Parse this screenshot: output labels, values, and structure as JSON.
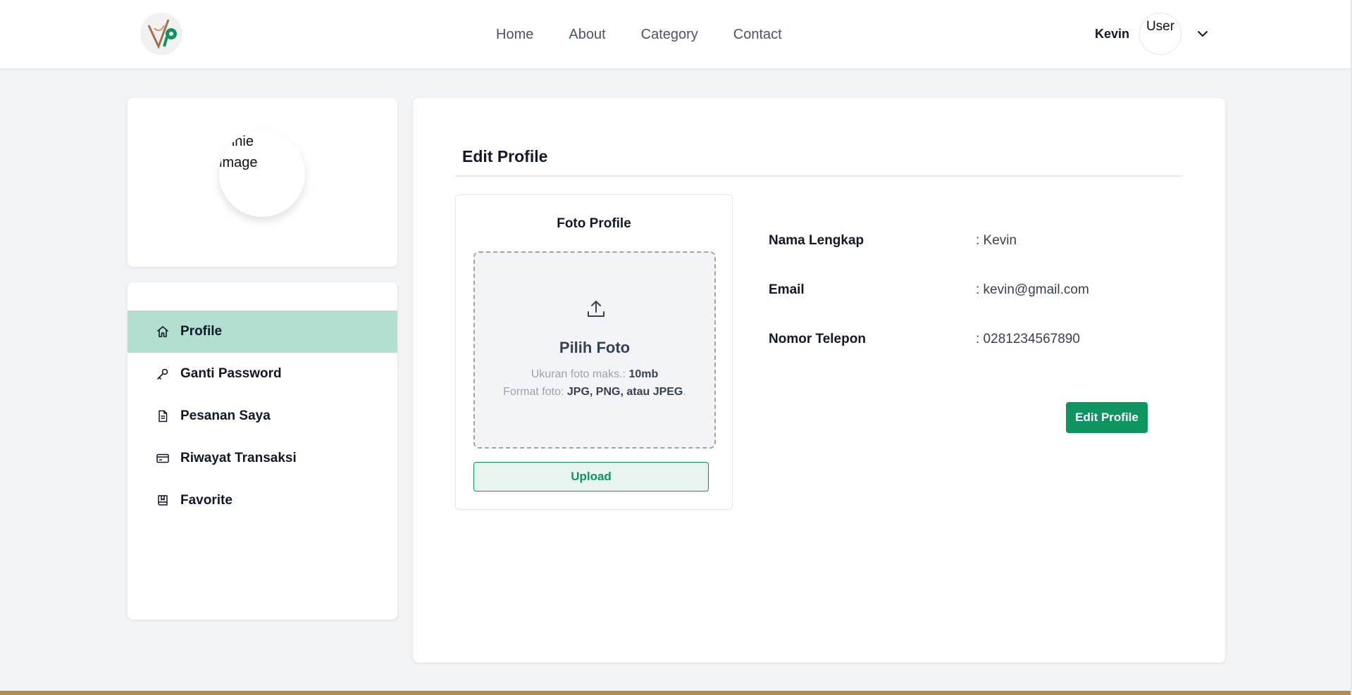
{
  "nav": {
    "links": [
      {
        "label": "Home"
      },
      {
        "label": "About"
      },
      {
        "label": "Category"
      },
      {
        "label": "Contact"
      }
    ],
    "user_name": "Kevin",
    "avatar_alt": "User"
  },
  "sidebar": {
    "avatar_alt": "onnie\nimage",
    "items": [
      {
        "label": "Profile",
        "icon": "home-icon",
        "active": true
      },
      {
        "label": "Ganti Password",
        "icon": "key-icon",
        "active": false
      },
      {
        "label": "Pesanan Saya",
        "icon": "document-icon",
        "active": false
      },
      {
        "label": "Riwayat Transaksi",
        "icon": "credit-card-icon",
        "active": false
      },
      {
        "label": "Favorite",
        "icon": "bookmark-book-icon",
        "active": false
      }
    ]
  },
  "main": {
    "title": "Edit Profile",
    "photo": {
      "title": "Foto Profile",
      "dropzone_title": "Pilih Foto",
      "size_label": "Ukuran foto maks.: ",
      "size_value": "10mb",
      "format_label": "Format foto: ",
      "format_value": "JPG, PNG, atau JPEG",
      "format_suffix": ".",
      "upload_label": "Upload"
    },
    "fields": [
      {
        "label": "Nama Lengkap",
        "value": ": Kevin"
      },
      {
        "label": "Email",
        "value": ": kevin@gmail.com"
      },
      {
        "label": "Nomor Telepon",
        "value": ": 0281234567890"
      }
    ],
    "edit_button": "Edit Profile"
  },
  "colors": {
    "primary": "#0d9460",
    "active_menu_bg": "#b3dfd0",
    "page_bg": "#f3f4f6",
    "footer_bar": "#b08d4a"
  }
}
